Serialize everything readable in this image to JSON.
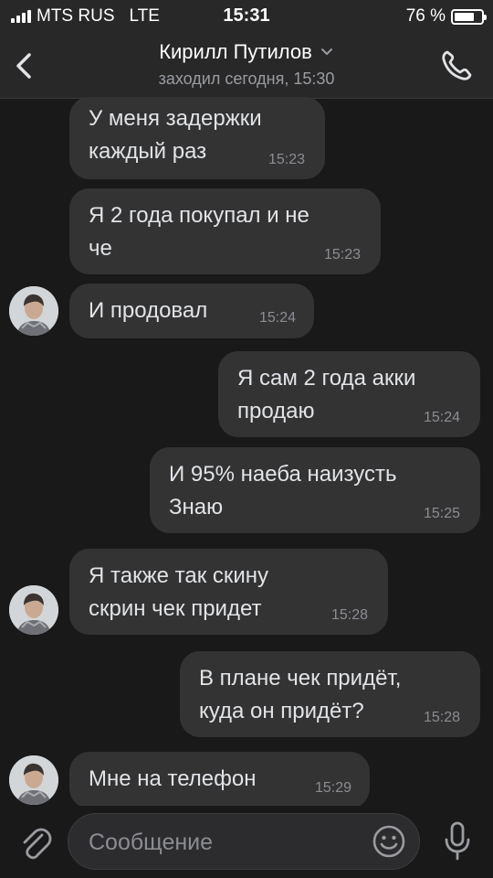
{
  "status_bar": {
    "carrier": "MTS RUS",
    "network": "LTE",
    "time": "15:31",
    "battery_percent": "76 %",
    "battery_level": 0.76
  },
  "header": {
    "contact_name": "Кирилл Путилов",
    "last_seen": "заходил сегодня, 15:30",
    "back_icon": "chevron-left-icon",
    "dropdown_icon": "chevron-down-icon",
    "call_icon": "phone-icon"
  },
  "messages": [
    {
      "direction": "incoming",
      "text": "У меня задержки\nкаждый раз",
      "time": "15:23",
      "avatar": false
    },
    {
      "direction": "incoming",
      "text": "Я 2 года покупал и не\nче",
      "time": "15:23",
      "avatar": false
    },
    {
      "direction": "incoming",
      "text": "И продовал",
      "time": "15:24",
      "avatar": true
    },
    {
      "direction": "outgoing",
      "text": "Я сам 2 года акки\nпродаю",
      "time": "15:24"
    },
    {
      "direction": "outgoing",
      "text": "И 95% наеба наизусть\nЗнаю",
      "time": "15:25"
    },
    {
      "direction": "incoming",
      "text": "Я также так скину\nскрин чек придет",
      "time": "15:28",
      "avatar": true
    },
    {
      "direction": "outgoing",
      "text": "В плане чек придёт,\nкуда он придёт?",
      "time": "15:28"
    },
    {
      "direction": "incoming",
      "text": "Мне на телефон",
      "time": "15:29",
      "avatar": true
    }
  ],
  "input_bar": {
    "placeholder": "Сообщение",
    "value": "",
    "attach_icon": "paperclip-icon",
    "emoji_icon": "smiley-icon",
    "mic_icon": "microphone-icon"
  },
  "colors": {
    "background": "#19191a",
    "bubble": "#333334",
    "header": "#282829",
    "text": "#e1e3e6",
    "secondary_text": "#8b8d92"
  }
}
